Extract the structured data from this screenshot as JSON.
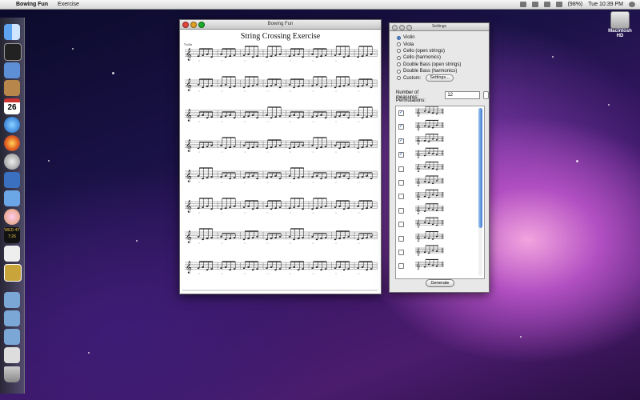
{
  "menubar": {
    "app_name": "Bowing Fun",
    "menu_item": "Exercise",
    "battery": "(98%)",
    "clock": "Tue 10:39 PM"
  },
  "desktop": {
    "disk_label": "Macintosh HD"
  },
  "dock": {
    "calendar_day": "26",
    "clock_date": "WED 4Y 7:26"
  },
  "document_window": {
    "title": "Bowing Fun",
    "score_title": "String Crossing Exercise",
    "instrument_label": "Violin"
  },
  "settings_panel": {
    "title": "Settings",
    "instruments": [
      {
        "label": "Violin",
        "selected": true
      },
      {
        "label": "Viola",
        "selected": false
      },
      {
        "label": "Cello (open strings)",
        "selected": false
      },
      {
        "label": "Cello (harmonics)",
        "selected": false
      },
      {
        "label": "Double Bass (open strings)",
        "selected": false
      },
      {
        "label": "Double Bass (harmonics)",
        "selected": false
      }
    ],
    "custom_label": "Custom:",
    "custom_button": "Settings...",
    "measures_label": "Number of measures:",
    "measures_value": "12",
    "permutations_label": "Permutations:",
    "permutations": [
      true,
      true,
      true,
      true,
      false,
      false,
      false,
      false,
      false,
      false,
      false,
      false
    ],
    "generate_button": "Generate"
  }
}
